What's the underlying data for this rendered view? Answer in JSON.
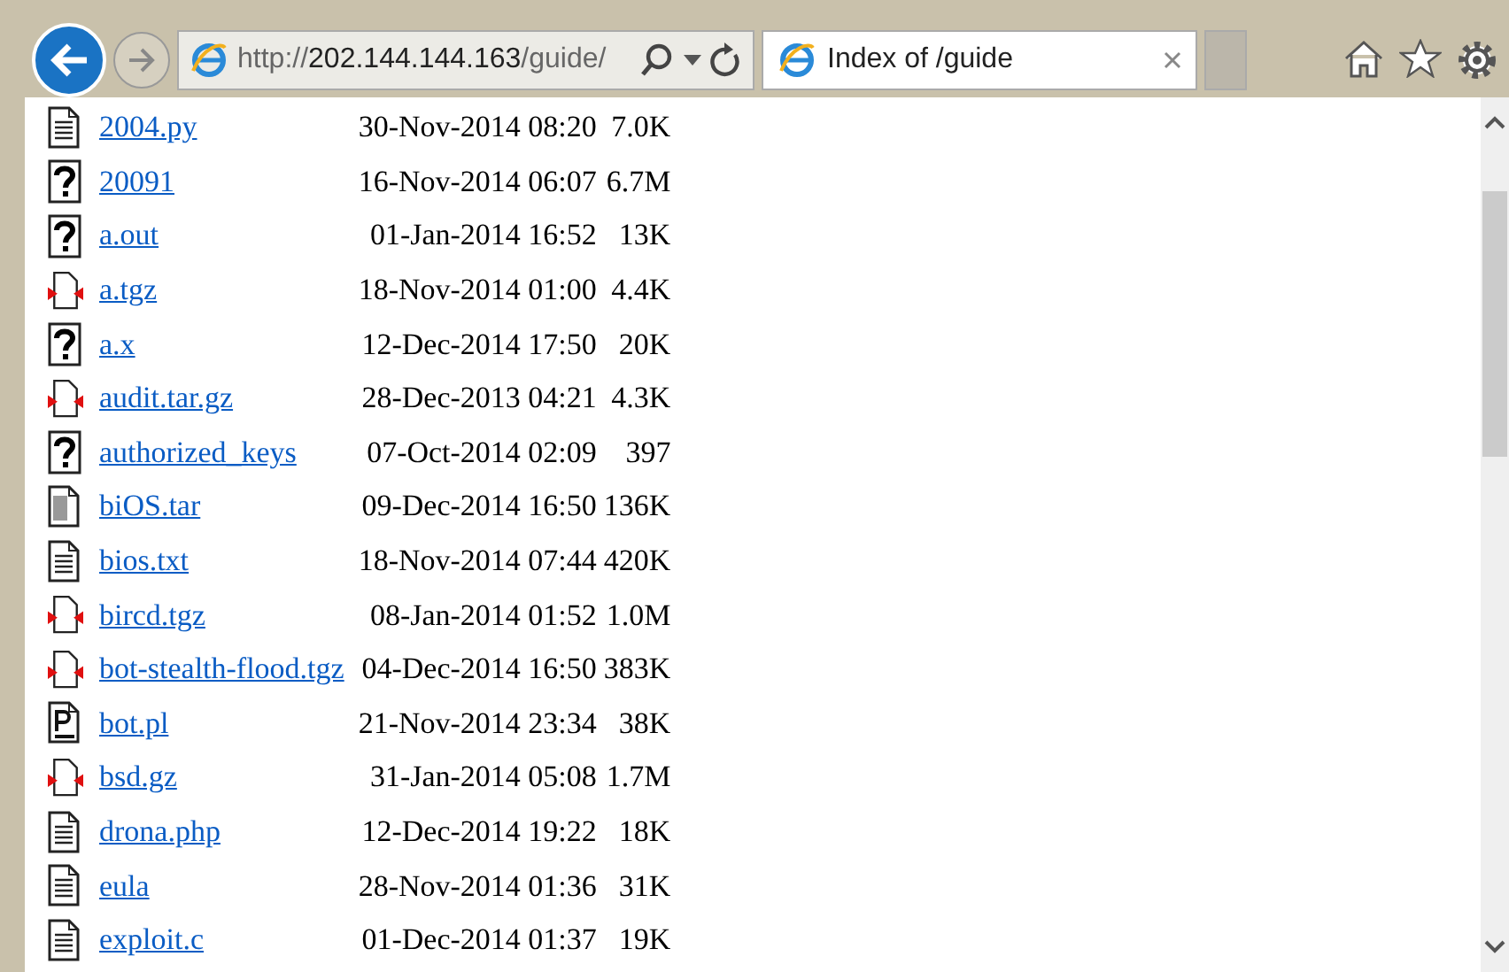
{
  "browser": {
    "address": {
      "scheme": "http://",
      "host": "202.144.144.163",
      "path": "/guide/"
    },
    "tabs": [
      {
        "title": "Index of /guide",
        "selected": true
      }
    ]
  },
  "listing": [
    {
      "name": "2004.py",
      "kind": "text",
      "modified": "30-Nov-2014 08:20",
      "size": "7.0K"
    },
    {
      "name": "20091",
      "kind": "unknown",
      "modified": "16-Nov-2014 06:07",
      "size": "6.7M"
    },
    {
      "name": "a.out",
      "kind": "unknown",
      "modified": "01-Jan-2014 16:52",
      "size": "13K"
    },
    {
      "name": "a.tgz",
      "kind": "compressed",
      "modified": "18-Nov-2014 01:00",
      "size": "4.4K"
    },
    {
      "name": "a.x",
      "kind": "unknown",
      "modified": "12-Dec-2014 17:50",
      "size": "20K"
    },
    {
      "name": "audit.tar.gz",
      "kind": "compressed",
      "modified": "28-Dec-2013 04:21",
      "size": "4.3K"
    },
    {
      "name": "authorized_keys",
      "kind": "unknown",
      "modified": "07-Oct-2014 02:09",
      "size": "397"
    },
    {
      "name": "biOS.tar",
      "kind": "tar",
      "modified": "09-Dec-2014 16:50",
      "size": "136K"
    },
    {
      "name": "bios.txt",
      "kind": "text",
      "modified": "18-Nov-2014 07:44",
      "size": "420K"
    },
    {
      "name": "bircd.tgz",
      "kind": "compressed",
      "modified": "08-Jan-2014 01:52",
      "size": "1.0M"
    },
    {
      "name": "bot-stealth-flood.tgz",
      "kind": "compressed",
      "modified": "04-Dec-2014 16:50",
      "size": "383K"
    },
    {
      "name": "bot.pl",
      "kind": "script",
      "modified": "21-Nov-2014 23:34",
      "size": "38K"
    },
    {
      "name": "bsd.gz",
      "kind": "compressed",
      "modified": "31-Jan-2014 05:08",
      "size": "1.7M"
    },
    {
      "name": "drona.php",
      "kind": "text",
      "modified": "12-Dec-2014 19:22",
      "size": "18K"
    },
    {
      "name": "eula",
      "kind": "text",
      "modified": "28-Nov-2014 01:36",
      "size": "31K"
    },
    {
      "name": "exploit.c",
      "kind": "text",
      "modified": "01-Dec-2014 01:37",
      "size": "19K"
    }
  ]
}
